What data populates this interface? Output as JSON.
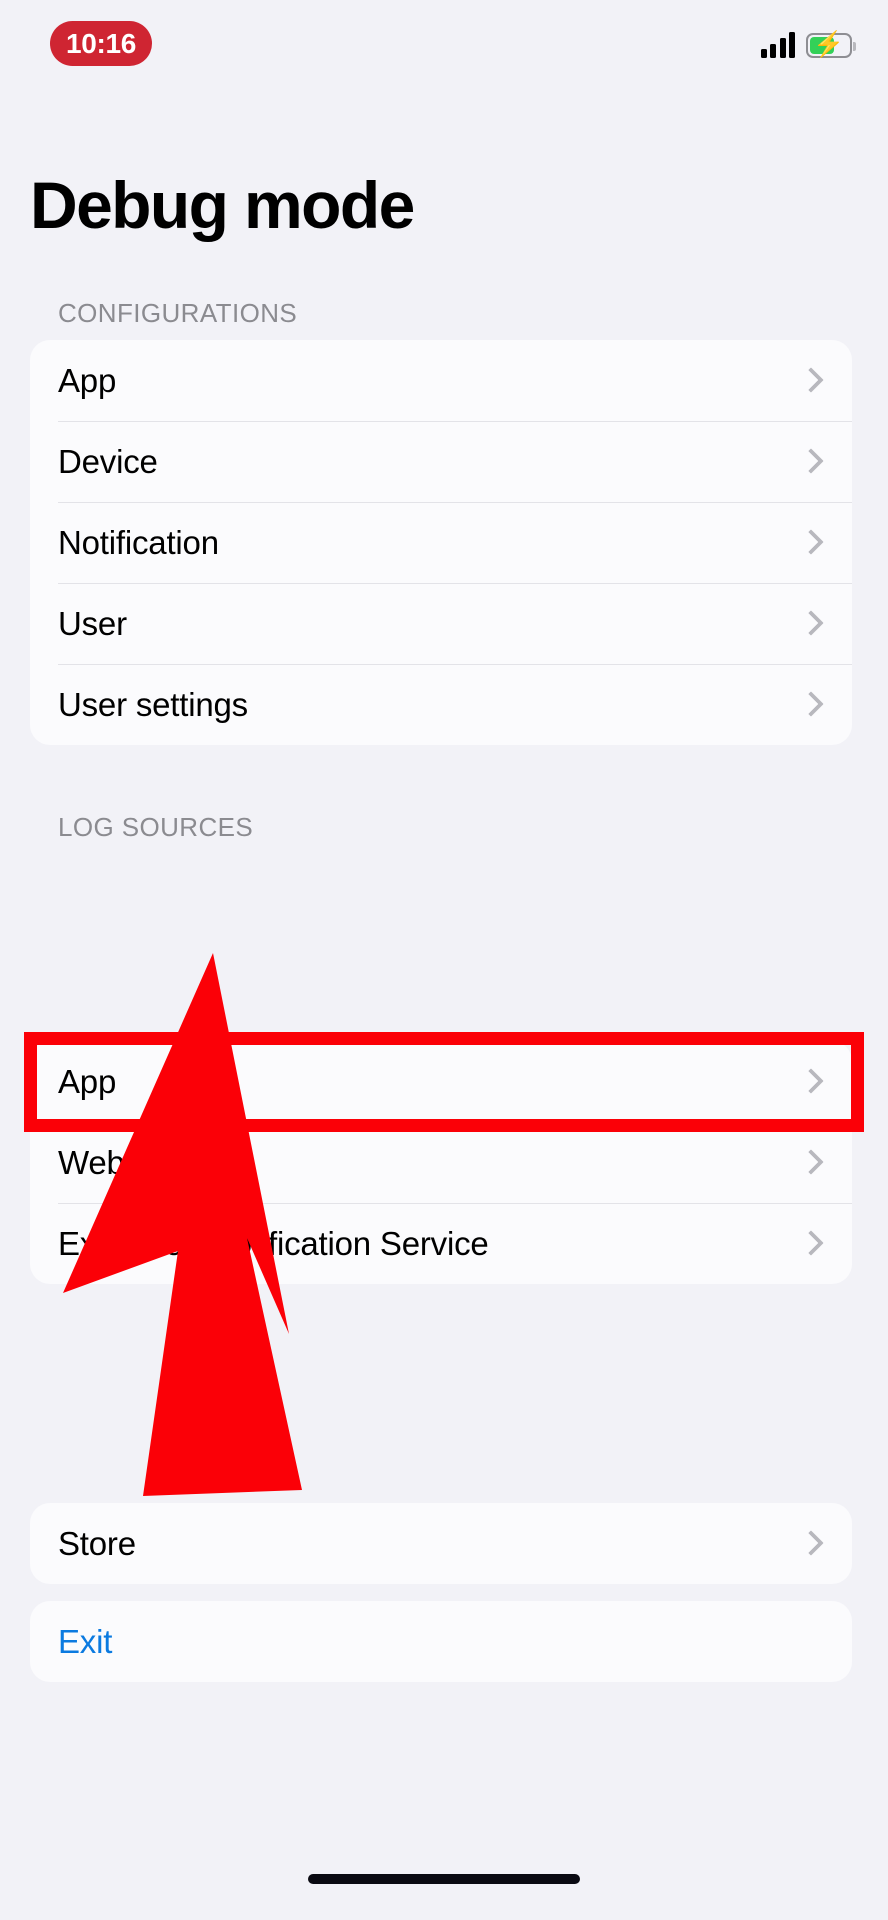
{
  "status_bar": {
    "time": "10:16",
    "time_pill_color": "#cf2532",
    "signal_icon": "cellular-signal-icon",
    "battery_icon": "battery-charging-icon",
    "battery_fill_color": "#33d158"
  },
  "page": {
    "title": "Debug mode",
    "background_color": "#f2f2f7",
    "card_color": "#fbfbfd"
  },
  "sections": [
    {
      "header": "CONFIGURATIONS",
      "rows": [
        {
          "label": "App"
        },
        {
          "label": "Device"
        },
        {
          "label": "Notification"
        },
        {
          "label": "User"
        },
        {
          "label": "User settings"
        }
      ]
    },
    {
      "header": "LOG SOURCES",
      "rows": [
        {
          "label": "App"
        },
        {
          "label": "Web"
        },
        {
          "label": "Extension Notification Service"
        }
      ]
    }
  ],
  "store_section": {
    "rows": [
      {
        "label": "Store"
      }
    ]
  },
  "exit_section": {
    "rows": [
      {
        "label": "Exit"
      }
    ],
    "link_color": "#0b7ae0"
  },
  "annotations": {
    "highlight": {
      "target_label": "App",
      "color": "#fb0007",
      "shape": "rectangle-outline"
    },
    "arrow": {
      "color": "#fb0007",
      "direction": "up",
      "points_to": "App"
    }
  },
  "home_indicator": {
    "present": true
  }
}
